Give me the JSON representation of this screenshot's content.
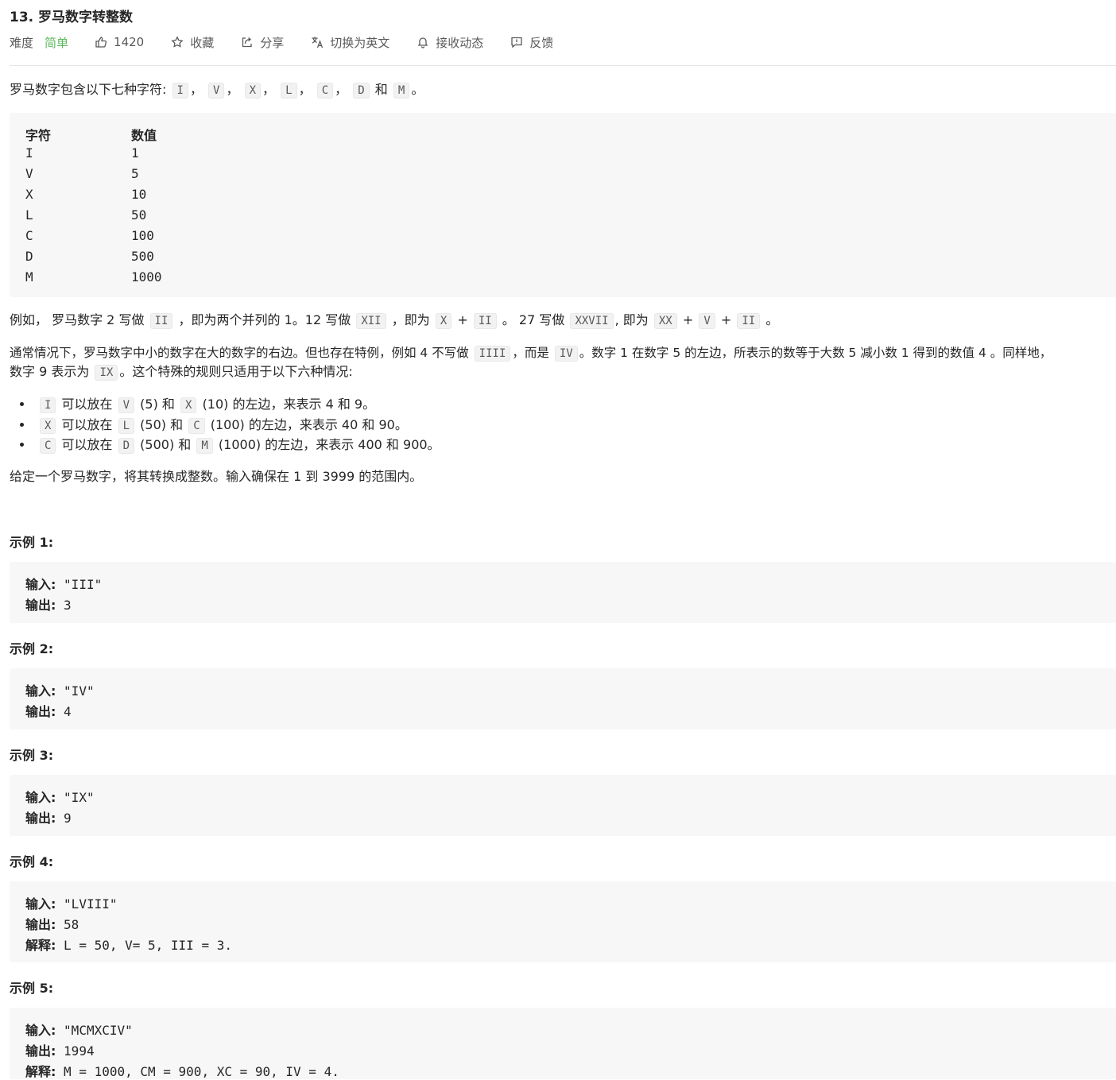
{
  "title": "13. 罗马数字转整数",
  "meta": {
    "difficulty_label": "难度",
    "difficulty": "简单",
    "likes": "1420",
    "favorite": "收藏",
    "share": "分享",
    "switch_lang": "切换为英文",
    "subscribe": "接收动态",
    "feedback": "反馈"
  },
  "colors": {
    "easy": "#5cb85c"
  },
  "icons": [
    "thumb-up-icon",
    "star-icon",
    "share-icon",
    "translate-icon",
    "bell-icon",
    "feedback-icon"
  ],
  "intro": {
    "text": "罗马数字包含以下七种字符:",
    "symbols": [
      "I",
      "V",
      "X",
      "L",
      "C",
      "D",
      "M"
    ],
    "sep": "，",
    "and": "和",
    "end": "。"
  },
  "table": {
    "headers": [
      "字符",
      "数值"
    ],
    "rows": [
      [
        "I",
        "1"
      ],
      [
        "V",
        "5"
      ],
      [
        "X",
        "10"
      ],
      [
        "L",
        "50"
      ],
      [
        "C",
        "100"
      ],
      [
        "D",
        "500"
      ],
      [
        "M",
        "1000"
      ]
    ]
  },
  "para1": {
    "t1": "例如， 罗马数字 2 写做",
    "c1": "II",
    "t2": "，即为两个并列的 1。12 写做",
    "c2": "XII",
    "t3": "，即为",
    "c3": "X",
    "plus": "+",
    "c4": "II",
    "t4": "。 27 写做",
    "c5": "XXVII",
    "t5": ", 即为",
    "c6": "XX",
    "c7": "V",
    "c8": "II",
    "t6": "。"
  },
  "para2": {
    "t1": "通常情况下，罗马数字中小的数字在大的数字的右边。但也存在特例，例如 4 不写做",
    "c1": "IIII",
    "t2": "，而是",
    "c2": "IV",
    "t3": "。数字 1 在数字 5 的左边，所表示的数等于大数 5 减小数 1 得到的数值 4 。同样地，",
    "t4": "数字 9 表示为",
    "c3": "IX",
    "t5": "。这个特殊的规则只适用于以下六种情况:"
  },
  "rules": [
    {
      "a": "I",
      "t1": "可以放在",
      "b": "V",
      "t2": "(5) 和",
      "c": "X",
      "t3": "(10) 的左边，来表示 4 和 9。"
    },
    {
      "a": "X",
      "t1": "可以放在",
      "b": "L",
      "t2": "(50) 和",
      "c": "C",
      "t3": "(100) 的左边，来表示 40 和 90。"
    },
    {
      "a": "C",
      "t1": "可以放在",
      "b": "D",
      "t2": "(500) 和",
      "c": "M",
      "t3": "(1000) 的左边，来表示 400 和 900。"
    }
  ],
  "para3": "给定一个罗马数字，将其转换成整数。输入确保在 1 到 3999 的范围内。",
  "labels": {
    "input": "输入:",
    "output": "输出:",
    "explain": "解释:"
  },
  "examples": [
    {
      "title": "示例 1:",
      "input": "\"III\"",
      "output": "3"
    },
    {
      "title": "示例 2:",
      "input": "\"IV\"",
      "output": "4"
    },
    {
      "title": "示例 3:",
      "input": "\"IX\"",
      "output": "9"
    },
    {
      "title": "示例 4:",
      "input": "\"LVIII\"",
      "output": "58",
      "explain": "L = 50, V= 5, III = 3."
    },
    {
      "title": "示例 5:",
      "input": "\"MCMXCIV\"",
      "output": "1994",
      "explain": "M = 1000, CM = 900, XC = 90, IV = 4."
    }
  ]
}
